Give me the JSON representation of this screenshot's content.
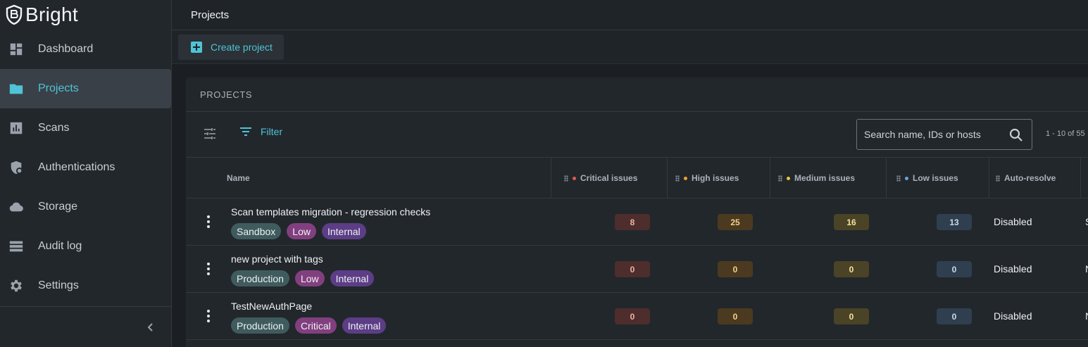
{
  "brand": {
    "name": "Bright"
  },
  "sidebar": {
    "items": [
      {
        "label": "Dashboard",
        "icon": "dashboard-icon",
        "active": false
      },
      {
        "label": "Projects",
        "icon": "folder-icon",
        "active": true
      },
      {
        "label": "Scans",
        "icon": "bar-chart-icon",
        "active": false
      },
      {
        "label": "Authentications",
        "icon": "shield-lock-icon",
        "active": false
      },
      {
        "label": "Storage",
        "icon": "cloud-icon",
        "active": false
      },
      {
        "label": "Audit log",
        "icon": "list-icon",
        "active": false
      },
      {
        "label": "Settings",
        "icon": "gear-icon",
        "active": false
      }
    ],
    "collapse_icon": "chevron-left-icon"
  },
  "header": {
    "title": "Projects"
  },
  "actions": {
    "create_label": "Create project"
  },
  "card": {
    "title": "PROJECTS",
    "filter_label": "Filter",
    "search_placeholder": "Search name, IDs or hosts",
    "pagination": "1 - 10 of 55"
  },
  "table": {
    "columns": {
      "name": "Name",
      "critical": "Critical issues",
      "high": "High issues",
      "medium": "Medium issues",
      "low": "Low issues",
      "autoresolve": "Auto-resolve"
    },
    "severity_colors": {
      "critical": "#e05a4f",
      "high": "#f0a030",
      "medium": "#e8c53a",
      "low": "#6fa3d8"
    },
    "rows": [
      {
        "name": "Scan templates migration - regression checks",
        "tags": [
          "Sandbox",
          "Low",
          "Internal"
        ],
        "critical": "8",
        "high": "25",
        "medium": "16",
        "low": "13",
        "autoresolve": "Disabled",
        "next": "S"
      },
      {
        "name": "new project with tags",
        "tags": [
          "Production",
          "Low",
          "Internal"
        ],
        "critical": "0",
        "high": "0",
        "medium": "0",
        "low": "0",
        "autoresolve": "Disabled",
        "next": "N"
      },
      {
        "name": "TestNewAuthPage",
        "tags": [
          "Production",
          "Critical",
          "Internal"
        ],
        "critical": "0",
        "high": "0",
        "medium": "0",
        "low": "0",
        "autoresolve": "Disabled",
        "next": "N"
      }
    ]
  }
}
